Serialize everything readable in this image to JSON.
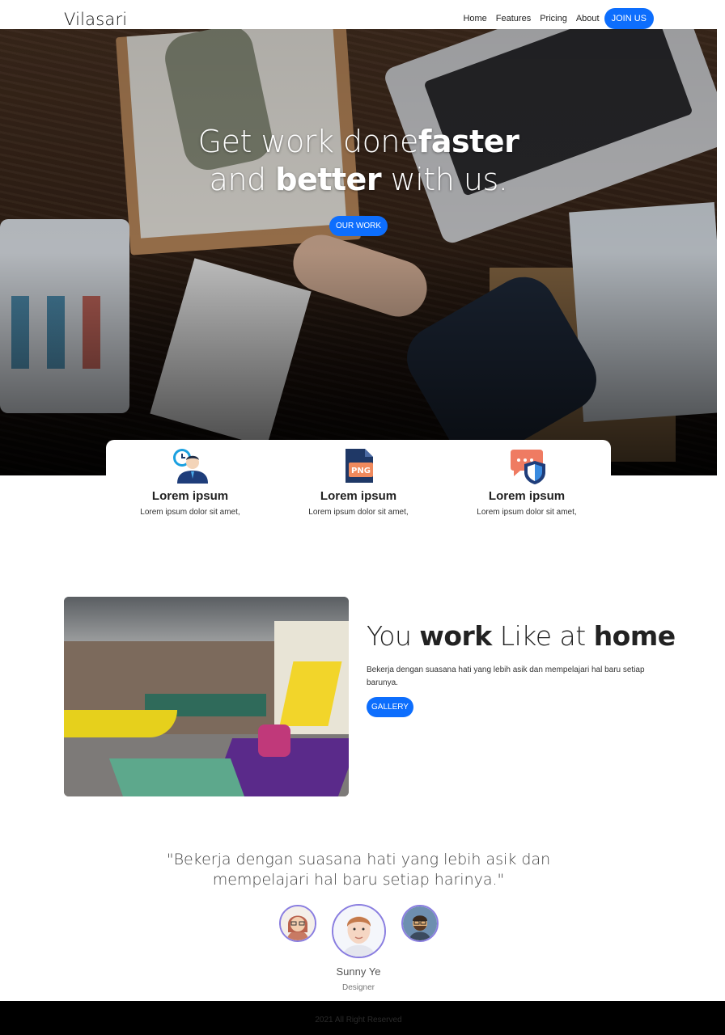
{
  "brand": "Vilasari",
  "nav": {
    "items": [
      "Home",
      "Features",
      "Pricing",
      "About"
    ],
    "cta": "JOIN US"
  },
  "hero": {
    "line1_a": "Get work done",
    "line1_b": "faster",
    "line2_a": "and ",
    "line2_b": "better",
    "line2_c": " with us.",
    "button": "OUR WORK"
  },
  "features": [
    {
      "icon": "clock-user-icon",
      "title": "Lorem ipsum",
      "text": "Lorem ipsum dolor sit amet,"
    },
    {
      "icon": "png-file-icon",
      "title": "Lorem ipsum",
      "text": "Lorem ipsum dolor sit amet,",
      "badge": "PNG"
    },
    {
      "icon": "chat-shield-icon",
      "title": "Lorem ipsum",
      "text": "Lorem ipsum dolor sit amet,"
    }
  ],
  "work": {
    "title_a": "You ",
    "title_b": "work",
    "title_c": " Like at ",
    "title_d": "home",
    "text": "Bekerja dengan suasana hati yang lebih asik dan mempelajari hal baru setiap barunya.",
    "button": "GALLERY"
  },
  "testimonial": {
    "quote_line1": "\"Bekerja dengan suasana hati yang lebih asik dan",
    "quote_line2": "mempelajari hal baru setiap harinya.\"",
    "name": "Sunny Ye",
    "role": "Designer"
  },
  "footer": {
    "text": "2021 All Right Reserved"
  },
  "colors": {
    "accent": "#0d6efd",
    "footer_bg": "#000000",
    "avatar_border": "#8a7ee0"
  }
}
